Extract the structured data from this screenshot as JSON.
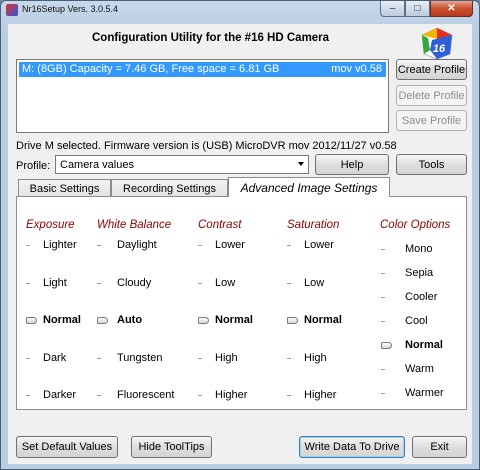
{
  "window": {
    "title": "Nr16Setup  Vers. 3.0.5.4"
  },
  "header": {
    "title": "Configuration Utility for the #16 HD Camera",
    "logo_text": "16"
  },
  "drives": [
    {
      "label": "M: (8GB) Capacity = 7.46 GB, Free space = 6.81 GB",
      "version": "mov v0.58"
    }
  ],
  "profile_buttons": {
    "create": "Create Profile",
    "delete": "Delete Profile",
    "save": "Save Profile"
  },
  "status": "Drive M selected. Firmware version is (USB) MicroDVR mov 2012/11/27 v0.58",
  "profile": {
    "label": "Profile:",
    "selected": "Camera values"
  },
  "buttons": {
    "help": "Help",
    "tools": "Tools",
    "set_default": "Set Default Values",
    "hide_tooltips": "Hide ToolTips",
    "write_data": "Write Data To Drive",
    "exit": "Exit"
  },
  "tabs": [
    {
      "label": "Basic Settings"
    },
    {
      "label": "Recording Settings"
    },
    {
      "label": "Advanced Image Settings",
      "active": true
    }
  ],
  "groups": [
    {
      "title": "Exposure",
      "options": [
        "Lighter",
        "Light",
        "Normal",
        "Dark",
        "Darker"
      ],
      "selected": 2
    },
    {
      "title": "White Balance",
      "options": [
        "Daylight",
        "Cloudy",
        "Auto",
        "Tungsten",
        "Fluorescent"
      ],
      "selected": 2
    },
    {
      "title": "Contrast",
      "options": [
        "Lower",
        "Low",
        "Normal",
        "High",
        "Higher"
      ],
      "selected": 2
    },
    {
      "title": "Saturation",
      "options": [
        "Lower",
        "Low",
        "Normal",
        "High",
        "Higher"
      ],
      "selected": 2
    },
    {
      "title": "Color Options",
      "options": [
        "Mono",
        "Sepia",
        "Cooler",
        "Cool",
        "Normal",
        "Warm",
        "Warmer"
      ],
      "selected": 4
    }
  ],
  "colors": {
    "group_title": "#8b0000",
    "selection": "#3399ff"
  }
}
